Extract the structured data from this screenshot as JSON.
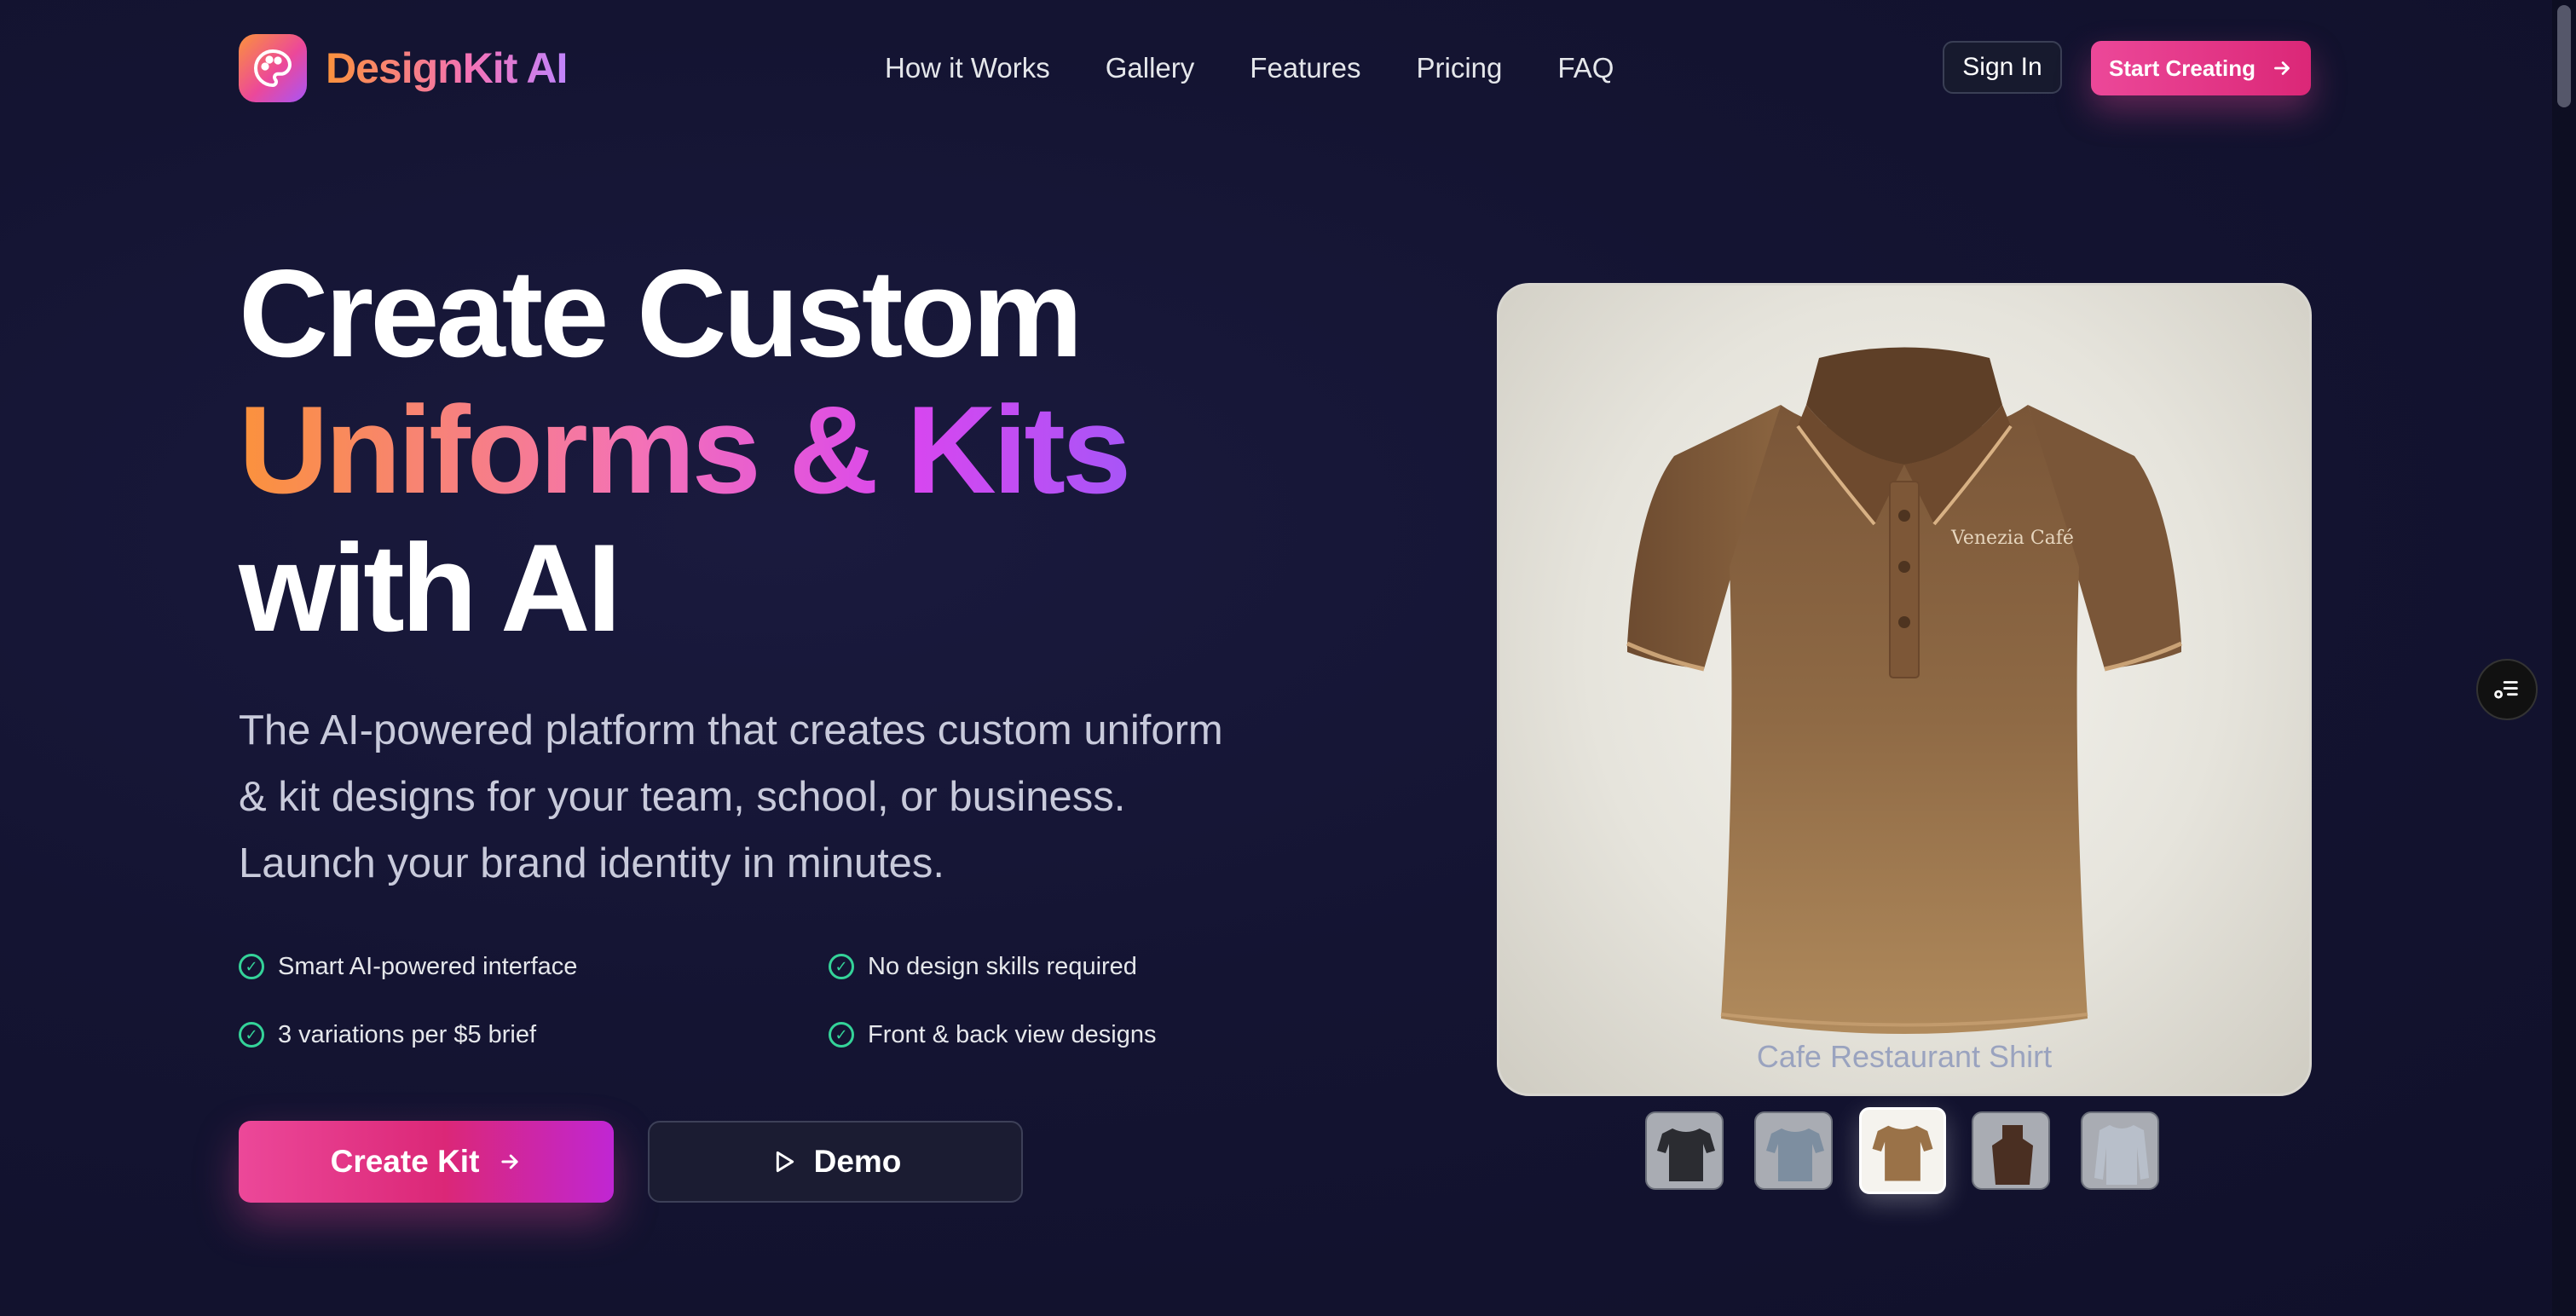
{
  "brand": {
    "name": "DesignKit AI",
    "logo_icon": "palette-icon"
  },
  "nav": {
    "items": [
      "How it Works",
      "Gallery",
      "Features",
      "Pricing",
      "FAQ"
    ]
  },
  "header": {
    "sign_in": "Sign In",
    "start_creating": "Start Creating"
  },
  "hero": {
    "line1": "Create Custom",
    "line2": "Uniforms & Kits",
    "line3": "with AI",
    "subtitle": "The AI-powered platform that creates custom uniform & kit designs for your team, school, or business. Launch your brand identity in minutes.",
    "features": [
      "Smart AI-powered interface",
      "No design skills required",
      "3 variations per $5 brief",
      "Front & back view designs"
    ],
    "create_kit": "Create Kit",
    "demo": "Demo"
  },
  "showcase": {
    "shirt_logo": "Venezia Café",
    "caption": "Cafe Restaurant Shirt",
    "thumbnails": [
      "sports-jersey",
      "polo-shirt",
      "cafe-polo",
      "apron",
      "dress-shirt"
    ],
    "active_index": 2
  },
  "colors": {
    "accent": "#ec4899",
    "check": "#34d399",
    "orange": "#fb923c",
    "purple": "#a855f7"
  }
}
